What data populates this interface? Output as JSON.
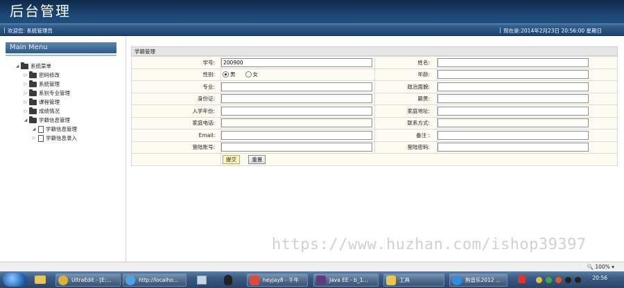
{
  "header": {
    "title": "后台管理"
  },
  "subbar": {
    "welcome": "欢迎您: 系统管理员",
    "datetime": "现在是:2014年2月23日 20:56:00 星期日"
  },
  "left_menu": {
    "title": "Main Menu",
    "items": [
      {
        "label": "系统菜单",
        "level": 0,
        "expanded": true
      },
      {
        "label": "密码修改",
        "level": 1
      },
      {
        "label": "系统管理",
        "level": 1
      },
      {
        "label": "系别专业管理",
        "level": 1
      },
      {
        "label": "课程管理",
        "level": 1
      },
      {
        "label": "成绩情况",
        "level": 1
      },
      {
        "label": "学籍信息管理",
        "level": 1,
        "expanded": true
      },
      {
        "label": "学籍信息管理",
        "level": 2,
        "expanded": true
      },
      {
        "label": "学籍信息录入",
        "level": 2
      }
    ]
  },
  "form": {
    "section_title": "学籍管理",
    "student_no_label": "学号:",
    "student_no_value": "200900",
    "name_label": "姓名:",
    "gender_label": "性别:",
    "gender_male": "男",
    "gender_female": "女",
    "age_label": "年龄:",
    "major_label": "专业:",
    "politics_label": "政治面貌:",
    "idcard_label": "身份证:",
    "native_label": "籍贯:",
    "enroll_label": "入学年份:",
    "address_label": "家庭地址:",
    "phone_label": "家庭电话:",
    "contact_label": "联系方式:",
    "email_label": "Email:",
    "remark_label": "备注 :",
    "login_label": "登陆账号:",
    "password_label": "登陆密码:",
    "submit_label": "提交",
    "reset_label": "重置"
  },
  "watermark": "https://www.huzhan.com/ishop39397",
  "statusbar": {
    "zoom": "100%"
  },
  "taskbar": {
    "items": [
      {
        "label": "UltraEdit - [E:..."
      },
      {
        "label": "http://localho..."
      },
      {
        "label": "heyjay8 - 千牛"
      },
      {
        "label": "Java EE - b_1..."
      },
      {
        "label": "工具"
      },
      {
        "label": "狗音乐2012 ..."
      }
    ],
    "clock": "20:56"
  },
  "colors": {
    "header_dark": "#0e2a4a",
    "accent": "#214f80",
    "form_bg": "#fbfbf1"
  }
}
